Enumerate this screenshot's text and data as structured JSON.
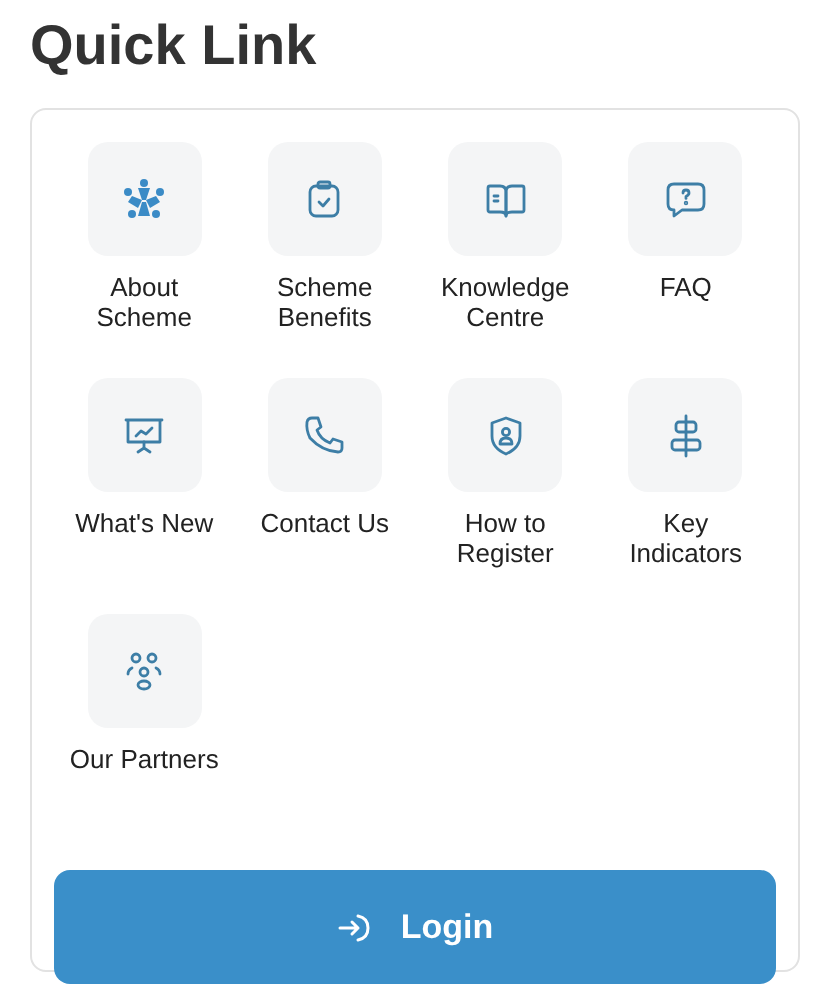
{
  "title": "Quick Link",
  "links": [
    {
      "label": "About Scheme",
      "kind": "people"
    },
    {
      "label": "Scheme Benefits",
      "kind": "clipboard"
    },
    {
      "label": "Knowledge Centre",
      "kind": "book"
    },
    {
      "label": "FAQ",
      "kind": "question"
    },
    {
      "label": "What's New",
      "kind": "presentation"
    },
    {
      "label": "Contact Us",
      "kind": "phone"
    },
    {
      "label": "How to Register",
      "kind": "shield"
    },
    {
      "label": "Key Indicators",
      "kind": "align"
    },
    {
      "label": "Our Partners",
      "kind": "group"
    }
  ],
  "login": {
    "label": "Login"
  }
}
